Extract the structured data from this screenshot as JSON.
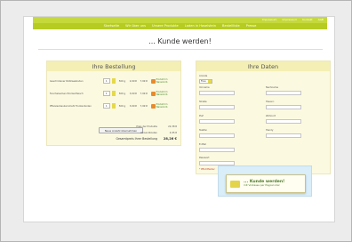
{
  "topbar": {
    "links": [
      "Impressum",
      "Impressum",
      "Kontakt",
      "AGB"
    ]
  },
  "nav": {
    "items": [
      "Startseite",
      "Wir über uns",
      "Unsere Produkte",
      "Laden in Haselstein",
      "Bestellliste",
      "Presse"
    ]
  },
  "page": {
    "title": "... Kunde werden!"
  },
  "order": {
    "heading": "Ihre Bestellung",
    "rows": [
      {
        "name": "Geschrotener Rotklaesboden",
        "qty": "1",
        "weight": "500 g",
        "price": "2,99 €",
        "total": "7,99 €",
        "link": "Produkt im Warenkorb"
      },
      {
        "name": "Fenchelsamen-Trockenfleisch",
        "qty": "1",
        "weight": "500 g",
        "price": "3,99 €",
        "total": "7,99 €",
        "link": "Produkt im Warenkorb"
      },
      {
        "name": "Pflanzenbaukernmehl Trockenboden",
        "qty": "1",
        "weight": "500 g",
        "price": "3,99 €",
        "total": "7,99 €",
        "link": "Produkt im Warenkorb"
      }
    ],
    "recalc_label": "Neue Anzahl übernehmen",
    "subtotal_label": "Preis der Produkte",
    "subtotal_value": "22,38 €",
    "shipping_label": "Versandkosten",
    "shipping_value": "4,95 €",
    "total_label": "Gesamtpreis Ihrer Bestellung",
    "total_value": "28,26 €"
  },
  "customer": {
    "heading": "Ihre Daten",
    "anrede_label": "Anrede",
    "anrede_value": "Frau",
    "fields": {
      "vorname": "Vorname",
      "nachname": "Nachname",
      "strasse": "Straße",
      "hausnr": "Hausnr.",
      "plz": "PLZ",
      "wohnort": "Wohnort",
      "telefon": "Telefon",
      "handy": "Handy",
      "email": "E-Mail",
      "passwort": "Passwort"
    },
    "required_note": "* Pflichtfelder"
  },
  "cta": {
    "main": "... Kunde werden!",
    "sub": "mit Vorkasse per Paypal oder"
  }
}
